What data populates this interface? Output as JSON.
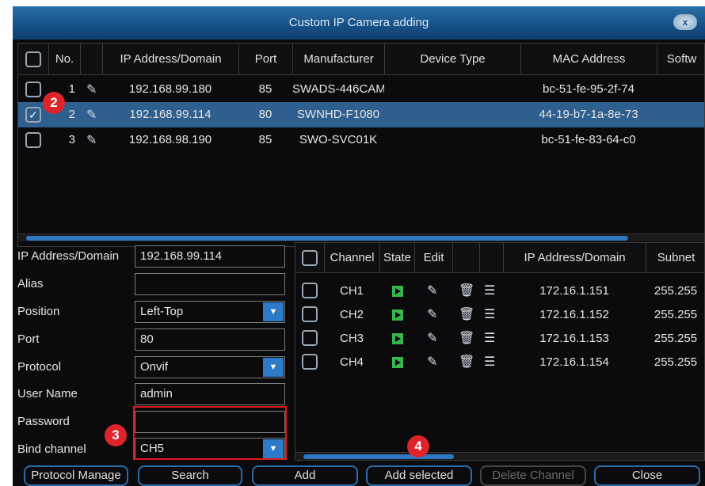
{
  "window": {
    "title": "Custom IP Camera adding",
    "close_label": "x"
  },
  "camera_table": {
    "columns": [
      "No.",
      "IP Address/Domain",
      "Port",
      "Manufacturer",
      "Device Type",
      "MAC Address",
      "Softw"
    ],
    "rows": [
      {
        "no": "1",
        "ip": "192.168.99.180",
        "port": "85",
        "manufacturer": "SWADS-446CAM",
        "device_type": "",
        "mac": "bc-51-fe-95-2f-74",
        "checked": false,
        "selected": false
      },
      {
        "no": "2",
        "ip": "192.168.99.114",
        "port": "80",
        "manufacturer": "SWNHD-F1080",
        "device_type": "",
        "mac": "44-19-b7-1a-8e-73",
        "checked": true,
        "selected": true
      },
      {
        "no": "3",
        "ip": "192.168.98.190",
        "port": "85",
        "manufacturer": "SWO-SVC01K",
        "device_type": "",
        "mac": "bc-51-fe-83-64-c0",
        "checked": false,
        "selected": false
      }
    ]
  },
  "form": {
    "ip_label": "IP Address/Domain",
    "ip_value": "192.168.99.114",
    "alias_label": "Alias",
    "alias_value": "",
    "position_label": "Position",
    "position_value": "Left-Top",
    "port_label": "Port",
    "port_value": "80",
    "protocol_label": "Protocol",
    "protocol_value": "Onvif",
    "username_label": "User Name",
    "username_value": "admin",
    "password_label": "Password",
    "password_value": "",
    "bind_label": "Bind channel",
    "bind_value": "CH5"
  },
  "channel_table": {
    "columns": [
      "Channel",
      "State",
      "Edit",
      "IP Address/Domain",
      "Subnet"
    ],
    "rows": [
      {
        "channel": "CH1",
        "ip": "172.16.1.151",
        "subnet": "255.255"
      },
      {
        "channel": "CH2",
        "ip": "172.16.1.152",
        "subnet": "255.255"
      },
      {
        "channel": "CH3",
        "ip": "172.16.1.153",
        "subnet": "255.255"
      },
      {
        "channel": "CH4",
        "ip": "172.16.1.154",
        "subnet": "255.255"
      }
    ]
  },
  "buttons": {
    "protocol_manage": "Protocol Manage",
    "search": "Search",
    "add": "Add",
    "add_selected": "Add selected",
    "delete_channel": "Delete Channel",
    "close": "Close"
  },
  "markers": {
    "m2": "2",
    "m3": "3",
    "m4": "4"
  },
  "colors": {
    "accent": "#2d7ac6",
    "selected_row": "#2e5f8e",
    "highlight": "#e0181c",
    "marker": "#e0232a",
    "play": "#39b54a"
  },
  "icons": {
    "edit_row": "edit-list-icon",
    "state": "play-icon",
    "pencil": "pencil-icon",
    "trash": "trash-icon",
    "dropdown": "chevron-down-icon"
  }
}
